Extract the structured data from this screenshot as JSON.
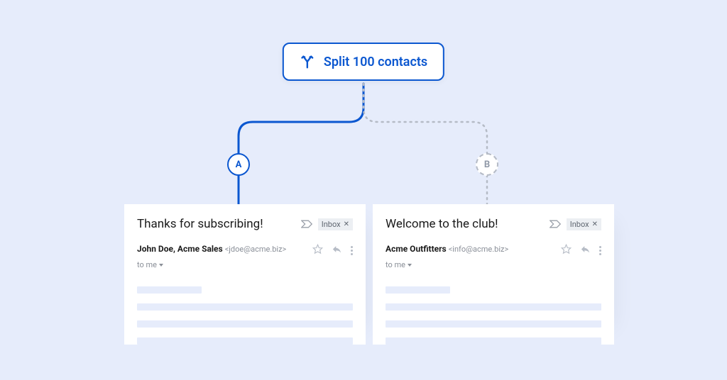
{
  "split": {
    "label": "Split 100 contacts",
    "icon": "split-icon"
  },
  "branches": {
    "a": {
      "letter": "A"
    },
    "b": {
      "letter": "B"
    }
  },
  "emails": {
    "a": {
      "subject": "Thanks for subscribing!",
      "inbox_tag": "Inbox",
      "sender_name": "John Doe, Acme Sales",
      "sender_email": "<jdoe@acme.biz>",
      "to_label": "to me"
    },
    "b": {
      "subject": "Welcome to the club!",
      "inbox_tag": "Inbox",
      "sender_name": "Acme Outfitters",
      "sender_email": "<info@acme.biz>",
      "to_label": "to me"
    }
  },
  "colors": {
    "accent": "#0b57d0",
    "bg": "#e6ecfb",
    "muted": "#b5bbc6"
  }
}
